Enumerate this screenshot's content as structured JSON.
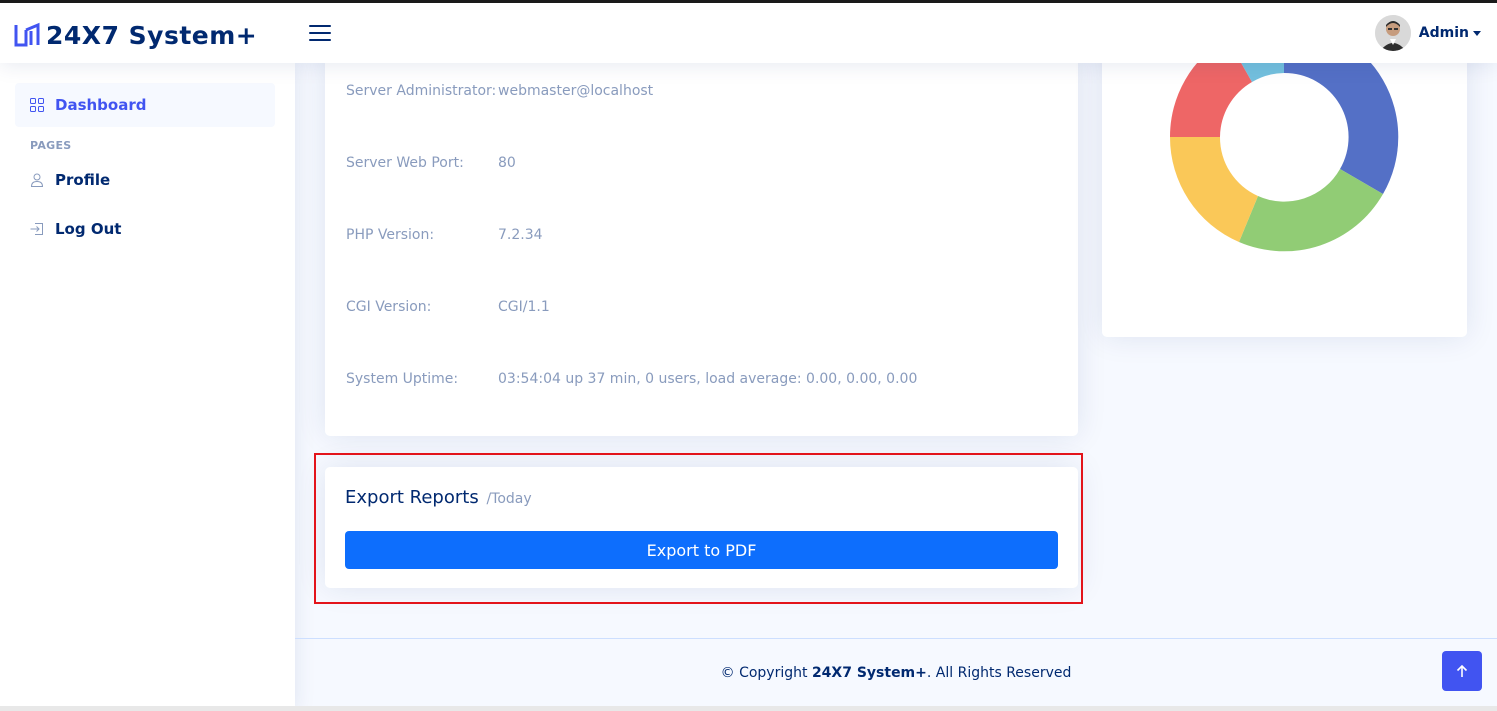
{
  "header": {
    "logo_text": "24X7 System+",
    "user_name": "Admin"
  },
  "sidebar": {
    "items": [
      {
        "label": "Dashboard",
        "icon": "grid-icon",
        "active": true
      },
      {
        "label": "Profile",
        "icon": "person-icon",
        "active": false
      },
      {
        "label": "Log Out",
        "icon": "box-arrow-in-right-icon",
        "active": false
      }
    ],
    "section_heading": "PAGES"
  },
  "server_info": {
    "rows": [
      {
        "key": "Server Administrator:",
        "value": "webmaster@localhost"
      },
      {
        "key": "Server Web Port:",
        "value": "80"
      },
      {
        "key": "PHP Version:",
        "value": "7.2.34"
      },
      {
        "key": "CGI Version:",
        "value": "CGI/1.1"
      },
      {
        "key": "System Uptime:",
        "value": "03:54:04 up 37 min, 0 users, load average: 0.00, 0.00, 0.00"
      }
    ]
  },
  "donut_chart": {
    "segment_colors": [
      "#5470c6",
      "#91cc75",
      "#fac858",
      "#ee6666",
      "#73c0de"
    ]
  },
  "export": {
    "title": "Export Reports",
    "subtitle": "/Today",
    "button_label": "Export to PDF"
  },
  "footer": {
    "prefix": "© Copyright ",
    "brand": "24X7 System+",
    "suffix": ". All Rights Reserved"
  },
  "colors": {
    "accent": "#4154f1",
    "primary_button": "#0d6efd",
    "navy": "#012970",
    "muted": "#899bbd",
    "highlight_border": "#e3141b"
  }
}
